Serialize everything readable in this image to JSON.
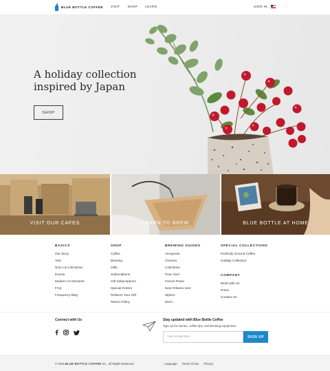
{
  "header": {
    "logo_text": "BLUE BOTTLE COFFEE",
    "nav": [
      "VISIT",
      "SHOP",
      "LEARN"
    ],
    "signin_label": "SIGN IN",
    "flag_icon": "us-flag-icon"
  },
  "hero": {
    "title_line1": "A holiday collection",
    "title_line2": "inspired by Japan",
    "button_label": "SHOP"
  },
  "tiles": [
    {
      "label": "VISIT OUR CAFES"
    },
    {
      "label": "LEARN TO BREW"
    },
    {
      "label": "BLUE BOTTLE AT HOME"
    }
  ],
  "footer": {
    "basics": {
      "title": "BASICS",
      "links": [
        "Our Story",
        "Visit",
        "NOLA & Cold Brew",
        "Events",
        "Modern Art Desserts",
        "FAQ",
        "Frequency Blog"
      ]
    },
    "shop": {
      "title": "SHOP",
      "links": [
        "Coffee",
        "Brewing",
        "Gifts",
        "Subscriptions",
        "Gift Subscriptions",
        "Special Orders",
        "Redeem Your Gift",
        "Return Policy"
      ]
    },
    "brewing": {
      "title": "BREWING GUIDES",
      "links": [
        "Aeropress",
        "Chemex",
        "Cold Brew",
        "Pour Over",
        "French Press",
        "New Orleans Iced",
        "Siphon",
        "More..."
      ]
    },
    "special": {
      "title": "SPECIAL COLLECTIONS",
      "links": [
        "Perfectly Ground Coffee",
        "Holiday Collection"
      ]
    },
    "company": {
      "title": "COMPANY",
      "links": [
        "Work with Us",
        "Press",
        "Contact Us"
      ]
    }
  },
  "newsletter": {
    "connect_title": "Connect with Us",
    "social_icons": [
      "facebook-icon",
      "instagram-icon",
      "twitter-icon"
    ],
    "title": "Stay updated with Blue Bottle Coffee",
    "subtitle": "Sign up for stories, coffee tips, and brewing equipment.",
    "email_placeholder": "Your email here",
    "signup_label": "SIGN UP"
  },
  "bottom": {
    "copyright_prefix": "© 2016",
    "copyright_brand": "BLUE BOTTLE COFFEE",
    "copyright_suffix": "Inc., All Rights Reserved.",
    "links": [
      "Language",
      "Terms of Use",
      "Privacy"
    ]
  },
  "colors": {
    "accent": "#1c89c9",
    "logo_blue": "#1d7fc2",
    "berry_red": "#c0192b",
    "leaf_green": "#5d8a3f"
  }
}
